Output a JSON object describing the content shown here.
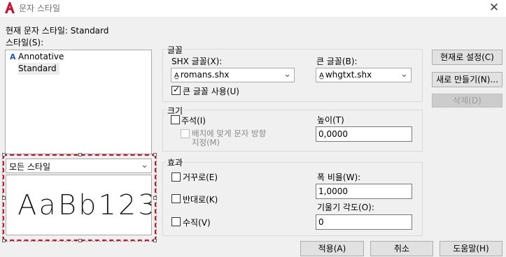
{
  "window": {
    "title": "문자 스타일",
    "close_icon": "close-icon"
  },
  "current_style": {
    "label": "현재 문자 스타일:",
    "value": "Standard"
  },
  "styles": {
    "label": "스타일(S):",
    "items": [
      {
        "label": "Annotative",
        "icon": "annotative-icon"
      },
      {
        "label": "Standard",
        "selected": true
      }
    ],
    "filter_value": "모든 스타일",
    "preview_text": "AaBb123"
  },
  "font": {
    "group_title": "글꼴",
    "shx_label": "SHX 글꼴(X):",
    "shx_value": "romans.shx",
    "big_label": "큰 글꼴(B):",
    "big_value": "whgtxt.shx",
    "use_big_font_label": "큰 글꼴 사용(U)",
    "use_big_font_checked": true
  },
  "size": {
    "group_title": "크기",
    "annotative_label": "주석(I)",
    "annotative_checked": false,
    "match_orientation_label_1": "배치에 맞게 문자 방향",
    "match_orientation_label_2": "지정(M)",
    "height_label": "높이(T)",
    "height_value": "0,0000"
  },
  "effects": {
    "group_title": "효과",
    "upside_down_label": "거꾸로(E)",
    "backwards_label": "반대로(K)",
    "vertical_label": "수직(V)",
    "width_factor_label": "폭 비율(W):",
    "width_factor_value": "1,0000",
    "oblique_label": "기울기 각도(O):",
    "oblique_value": "0"
  },
  "buttons": {
    "set_current": "현재로 설정(C)",
    "new": "새로 만들기(N)...",
    "delete": "삭제(D)",
    "apply": "적용(A)",
    "cancel": "취소",
    "help": "도움말(H)"
  },
  "colors": {
    "selection_frame": "#d0102a",
    "app_icon": "#c8102e"
  }
}
